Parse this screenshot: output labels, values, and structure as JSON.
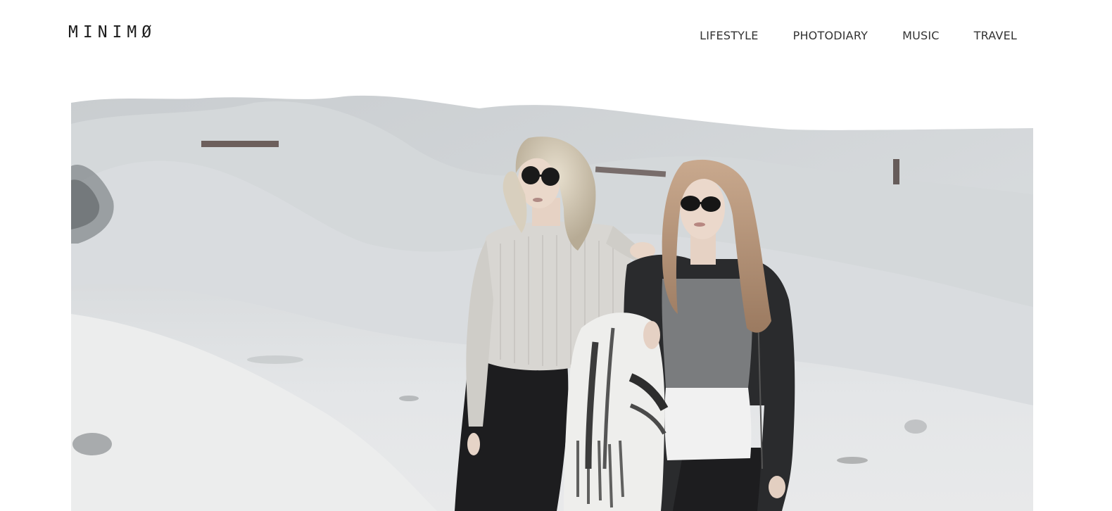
{
  "site": {
    "logo": "MINIMØ"
  },
  "nav": {
    "items": [
      {
        "label": "LIFESTYLE"
      },
      {
        "label": "PHOTODIARY"
      },
      {
        "label": "MUSIC"
      },
      {
        "label": "TRAVEL"
      }
    ]
  },
  "hero": {
    "description_icon": "photo"
  },
  "colors": {
    "text": "#333333",
    "logo": "#1c1c1c",
    "background": "#ffffff"
  }
}
